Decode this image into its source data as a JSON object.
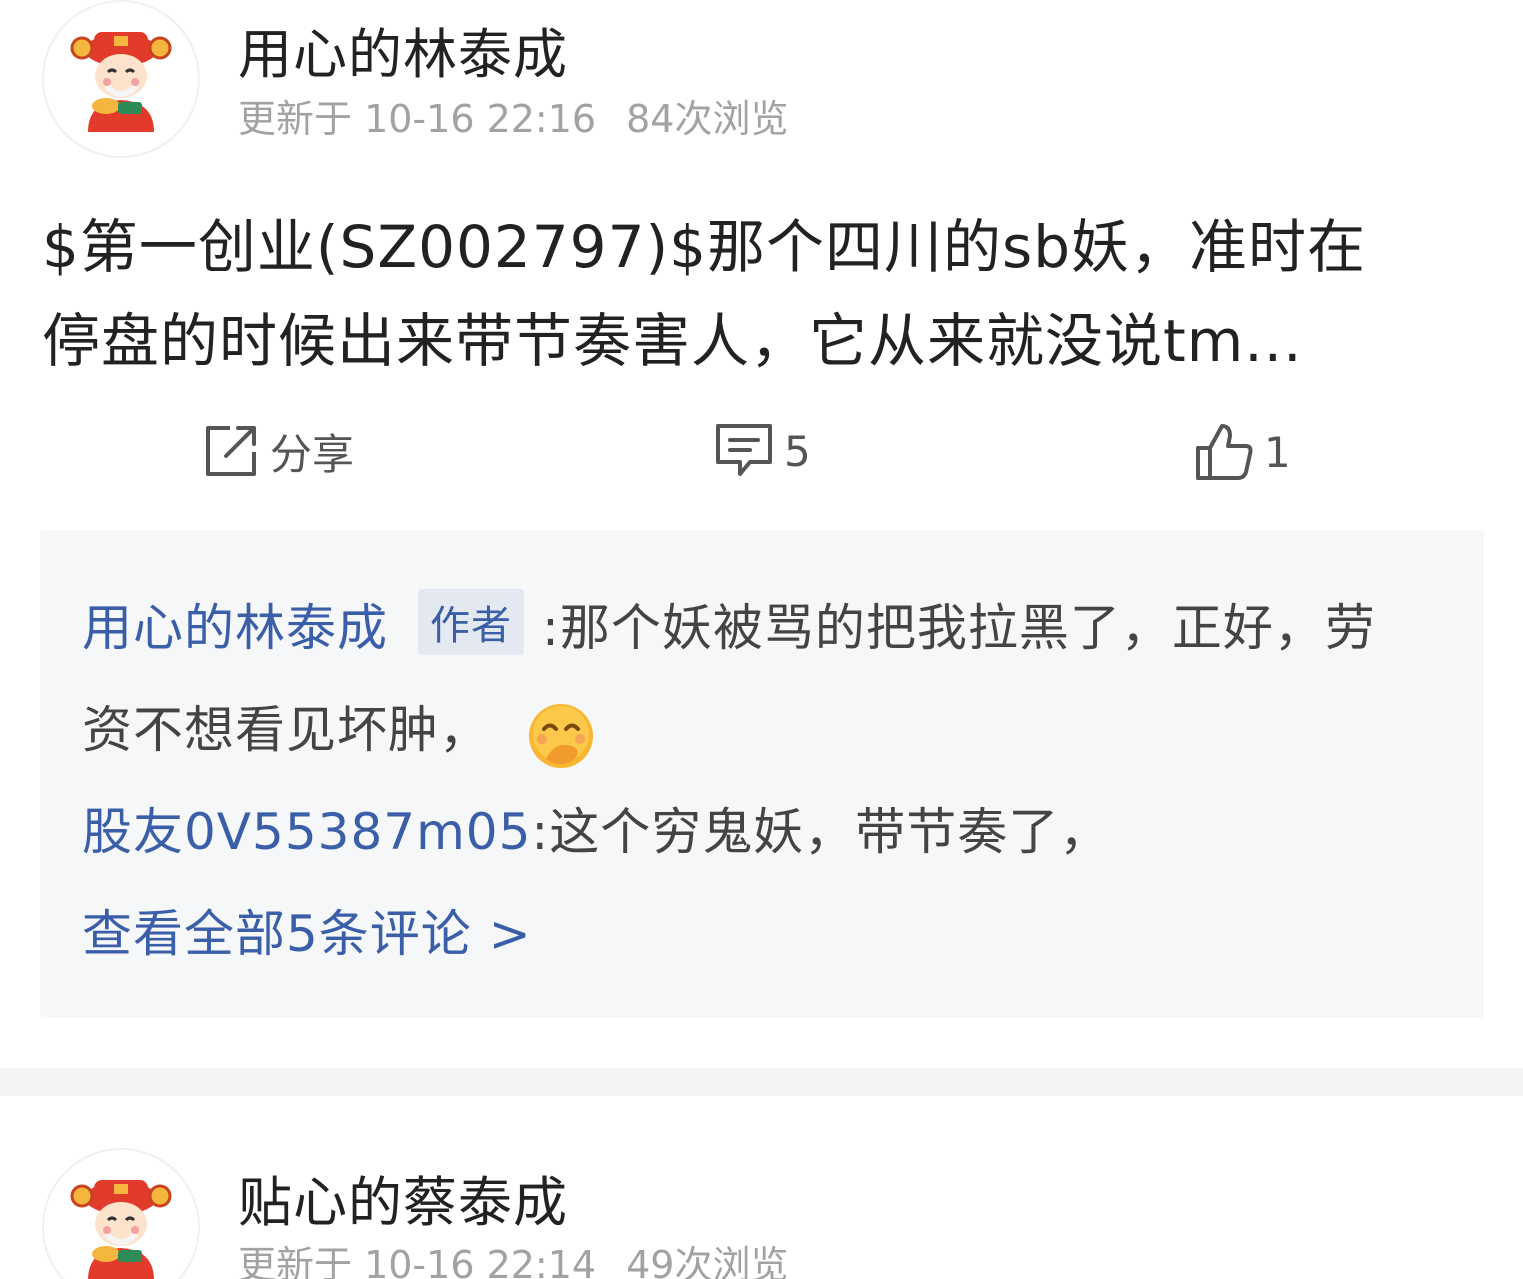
{
  "posts": [
    {
      "author": "用心的林泰成",
      "updated": "更新于 10-16 22:16",
      "views": "84次浏览",
      "content_line1": "$第一创业(SZ002797)$那个四川的sb妖，准时在",
      "content_line2": "停盘的时候出来带节奏害人，它从来就没说tm...",
      "share_label": "分享",
      "comment_count": "5",
      "like_count": "1",
      "comments": [
        {
          "user": "用心的林泰成",
          "badge": "作者",
          "text_part1": ":那个妖被骂的把我拉黑了，正好，劳",
          "text_part2": "资不想看见坏肿，",
          "emoji": "smirk-laugh-emoji-icon"
        },
        {
          "user": "股友0V55387m05",
          "text": ":这个穷鬼妖，带节奏了，"
        }
      ],
      "view_all": "查看全部5条评论 >"
    },
    {
      "author": "贴心的蔡泰成",
      "updated": "更新于 10-16 22:14",
      "views": "49次浏览"
    }
  ],
  "colors": {
    "link_blue": "#3a5ea8",
    "meta_gray": "#a2a2a2",
    "comment_bg": "#f6f7f9"
  },
  "icons": [
    "share-icon",
    "comment-icon",
    "like-icon"
  ]
}
